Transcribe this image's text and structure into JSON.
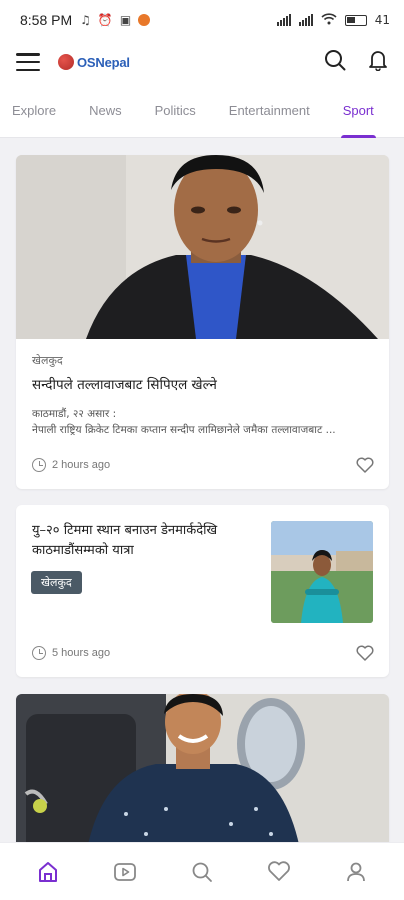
{
  "status_bar": {
    "time": "8:58 PM",
    "battery": "41"
  },
  "app": {
    "logo_text": "OSNepal",
    "brand_color": "#2b5fb8",
    "accent_color": "#7a2fd0"
  },
  "tabs": [
    {
      "label": "Explore"
    },
    {
      "label": "News"
    },
    {
      "label": "Politics"
    },
    {
      "label": "Entertainment"
    },
    {
      "label": "Sport",
      "active": true
    }
  ],
  "articles": [
    {
      "category": "खेलकुद",
      "title": "सन्दीपले तल्लावाजबाट सिपिएल खेल्ने",
      "excerpt_line1": "काठमाडौं, २२ असार :",
      "excerpt_line2": "नेपाली राष्ट्रिय क्रिकेट टिमका कप्तान सन्दीप लामिछानेले जमैका तल्लावाजबाट ...",
      "time": "2 hours ago",
      "liked": false
    },
    {
      "category": "खेलकुद",
      "title": "यु–२० टिममा स्थान बनाउन डेनमार्कदेखि काठमाडौंसम्मको यात्रा",
      "time": "5 hours ago",
      "liked": false
    }
  ],
  "bottom_nav": [
    {
      "icon": "home-icon",
      "active": true
    },
    {
      "icon": "video-icon"
    },
    {
      "icon": "search-icon"
    },
    {
      "icon": "heart-icon"
    },
    {
      "icon": "profile-icon"
    }
  ]
}
